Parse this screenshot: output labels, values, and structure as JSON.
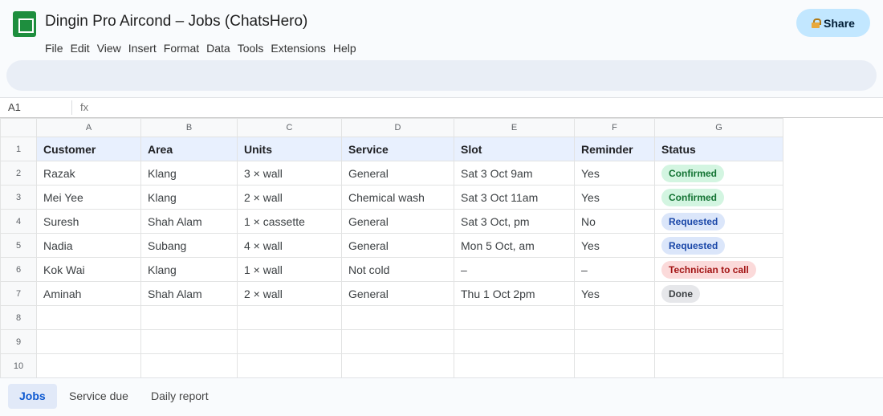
{
  "app": {
    "title": "Dingin Pro Aircond – Jobs (ChatsHero)",
    "share_label": "Share",
    "menu": [
      "File",
      "Edit",
      "View",
      "Insert",
      "Format",
      "Data",
      "Tools",
      "Extensions",
      "Help"
    ]
  },
  "formula_bar": {
    "cell_ref": "A1",
    "fx_label": "fx"
  },
  "sheet": {
    "columns": [
      "A",
      "B",
      "C",
      "D",
      "E",
      "F",
      "G"
    ],
    "row_numbers": [
      "1",
      "2",
      "3",
      "4",
      "5",
      "6",
      "7",
      "8",
      "9",
      "10"
    ],
    "headers": [
      "Customer",
      "Area",
      "Units",
      "Service",
      "Slot",
      "Reminder",
      "Status"
    ],
    "rows": [
      {
        "customer": "Razak",
        "area": "Klang",
        "units": "3 × wall",
        "service": "General",
        "slot": "Sat 3 Oct 9am",
        "reminder": "Yes",
        "status": "Confirmed",
        "status_type": "confirmed"
      },
      {
        "customer": "Mei Yee",
        "area": "Klang",
        "units": "2 × wall",
        "service": "Chemical wash",
        "slot": "Sat 3 Oct 11am",
        "reminder": "Yes",
        "status": "Confirmed",
        "status_type": "confirmed"
      },
      {
        "customer": "Suresh",
        "area": "Shah Alam",
        "units": "1 × cassette",
        "service": "General",
        "slot": "Sat 3 Oct, pm",
        "reminder": "No",
        "status": "Requested",
        "status_type": "requested"
      },
      {
        "customer": "Nadia",
        "area": "Subang",
        "units": "4 × wall",
        "service": "General",
        "slot": "Mon 5 Oct, am",
        "reminder": "Yes",
        "status": "Requested",
        "status_type": "requested"
      },
      {
        "customer": "Kok Wai",
        "area": "Klang",
        "units": "1 × wall",
        "service": "Not cold",
        "slot": "–",
        "reminder": "–",
        "status": "Technician to call",
        "status_type": "techcall"
      },
      {
        "customer": "Aminah",
        "area": "Shah Alam",
        "units": "2 × wall",
        "service": "General",
        "slot": "Thu 1 Oct 2pm",
        "reminder": "Yes",
        "status": "Done",
        "status_type": "done"
      }
    ]
  },
  "tabs": [
    {
      "label": "Jobs",
      "active": true
    },
    {
      "label": "Service due",
      "active": false
    },
    {
      "label": "Daily report",
      "active": false
    }
  ],
  "colors": {
    "confirmed": "#d3f5e1",
    "requested": "#dbe6fa",
    "technician_to_call": "#fbdada",
    "done": "#e6e7ea",
    "accent": "#0b57d0",
    "share_button": "#c2e7ff"
  },
  "icons": {
    "app_logo": "sheets-logo-icon",
    "share": "lock-icon"
  }
}
